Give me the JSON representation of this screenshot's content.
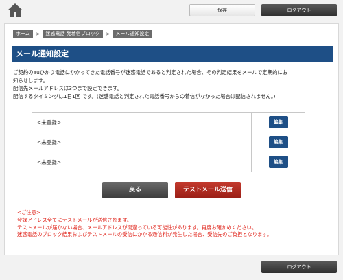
{
  "header": {
    "home_icon": "home-icon",
    "save_label": "保存",
    "logout_label": "ログアウト"
  },
  "breadcrumb": [
    "ホーム",
    "迷惑電話 発着信ブロック",
    "メール通知設定"
  ],
  "page_title": "メール通知設定",
  "description": {
    "line1": "ご契約のauひかり電話にかかってきた電話番号が迷惑電話であると判定された場合、その判定結果をメールで定期的にお",
    "line2": "知らせします。",
    "line3": "配信先メールアドレスは3つまで設定できます。",
    "line4": "配信するタイミングは1日1回 です。(迷惑電話と判定された電話番号からの着信がなかった場合は配信されません。)"
  },
  "registrations": [
    {
      "value": "<未登録>",
      "edit_label": "編集"
    },
    {
      "value": "<未登録>",
      "edit_label": "編集"
    },
    {
      "value": "<未登録>",
      "edit_label": "編集"
    }
  ],
  "actions": {
    "back_label": "戻る",
    "test_mail_label": "テストメール送信"
  },
  "notes": {
    "heading": "<ご注意>",
    "line1": "登録アドレス全てにテストメールが送信されます。",
    "line2": "テストメールが届かない場合、メールアドレスが間違っている可能性があります。再度お確かめください。",
    "line3": "迷惑電話のブロック結果およびテストメールの受信にかかる通信料が発生した場合、受信先のご負担となります。"
  },
  "footer": {
    "logout_label": "ログアウト"
  },
  "colors": {
    "title_bar": "#1e4f86",
    "edit_button": "#1e4f86",
    "test_button": "#b32a20",
    "notes_text": "#e0241b"
  }
}
